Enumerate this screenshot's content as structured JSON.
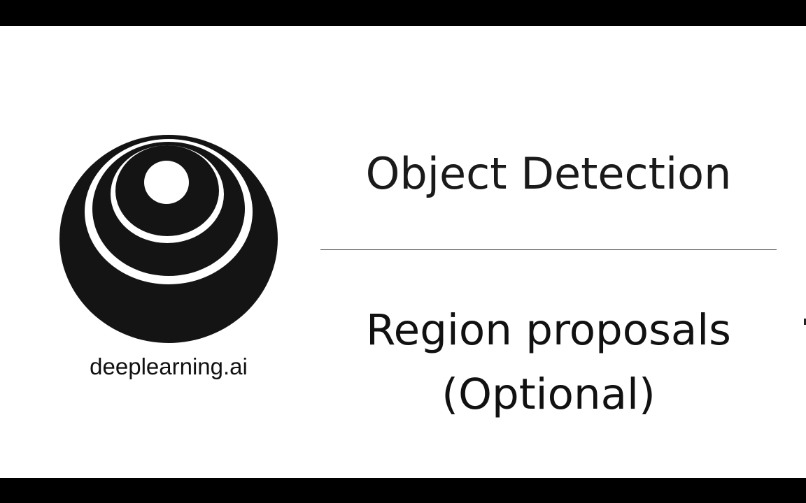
{
  "brand": {
    "name": "deeplearning.ai",
    "logo_icon": "deeplearning-ai-logo-icon"
  },
  "slide": {
    "title": "Object Detection",
    "subtitle_line1": "Region proposals",
    "subtitle_line2": "(Optional)"
  },
  "colors": {
    "letterbox": "#000000",
    "background": "#ffffff",
    "logo": "#141414",
    "text": "#111111"
  }
}
